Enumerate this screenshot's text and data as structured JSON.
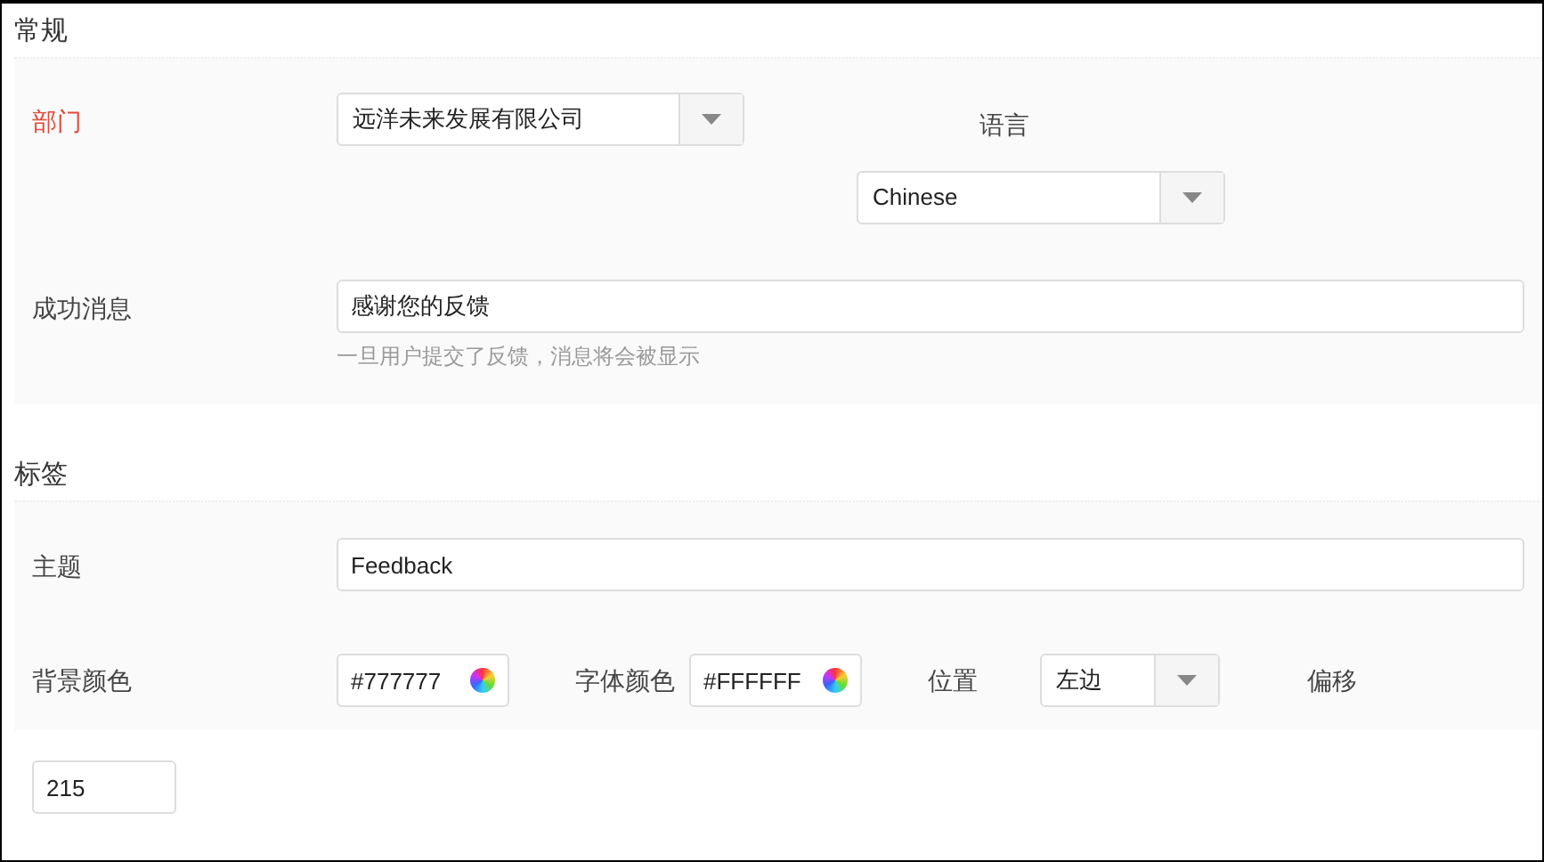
{
  "general": {
    "title": "常规",
    "department": {
      "label": "部门",
      "required": true,
      "value": "远洋未来发展有限公司"
    },
    "language": {
      "label": "语言",
      "required": false,
      "value": "Chinese"
    },
    "success_message": {
      "label": "成功消息",
      "required": false,
      "value": "感谢您的反馈",
      "hint": "一旦用户提交了反馈，消息将会被显示"
    }
  },
  "tab": {
    "title": "标签",
    "subject": {
      "label": "主题",
      "value": "Feedback"
    },
    "background_color": {
      "label": "背景颜色",
      "value": "#777777"
    },
    "font_color": {
      "label": "字体颜色",
      "value": "#FFFFFF"
    },
    "position": {
      "label": "位置",
      "value": "左边"
    },
    "offset": {
      "label": "偏移",
      "value": "215"
    }
  }
}
